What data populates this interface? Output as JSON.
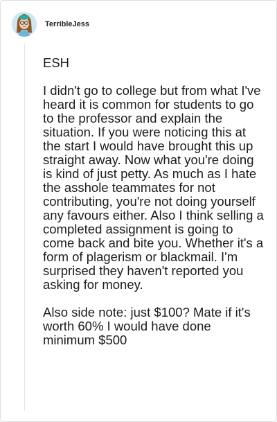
{
  "comment": {
    "username": "TerribleJess",
    "paragraphs": [
      "ESH",
      "I didn't go to college but from what I've heard it is common for students to go to the professor and explain the situation. If you were noticing this at the start I would have brought this up straight away. Now what you're doing is kind of just petty. As much as I hate the asshole teammates for not contributing, you're not doing yourself any favours either. Also I think selling a completed assignment is going to come back and bite you. Whether it's a form of plagerism or blackmail. I'm surprised they haven't reported you asking for money.",
      "Also side note: just $100? Mate if it's worth 60% I would have done minimum $500"
    ]
  }
}
